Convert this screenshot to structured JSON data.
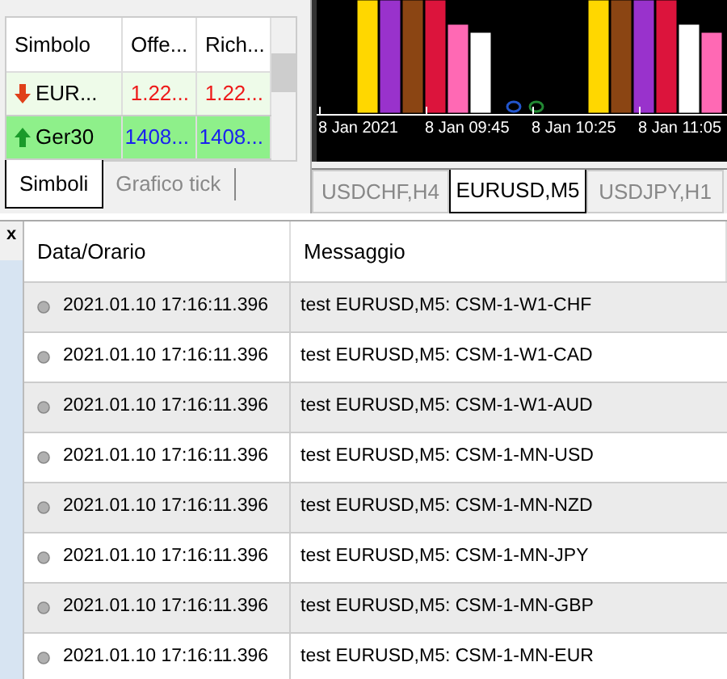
{
  "market_watch": {
    "columns": [
      "Simbolo",
      "Offe...",
      "Rich..."
    ],
    "rows": [
      {
        "symbol": "EUR...",
        "bid": "1.22...",
        "ask": "1.22...",
        "kind": "down"
      },
      {
        "symbol": "Ger30",
        "bid": "1408...",
        "ask": "1408...",
        "kind": "up"
      }
    ],
    "tabs": [
      {
        "label": "Simboli",
        "selected": true
      },
      {
        "label": "Grafico tick",
        "selected": false
      }
    ]
  },
  "chart": {
    "x_labels": [
      "8 Jan 2021",
      "8 Jan 09:45",
      "8 Jan 10:25",
      "8 Jan 11:05"
    ],
    "tabs": [
      {
        "label": "USDCHF,H4",
        "selected": false
      },
      {
        "label": "EURUSD,M5",
        "selected": true
      },
      {
        "label": "USDJPY,H1",
        "selected": false
      }
    ]
  },
  "journal": {
    "close": "x",
    "columns": [
      "Data/Orario",
      "Messaggio"
    ],
    "rows": [
      {
        "time": "2021.01.10 17:16:11.396",
        "message": "test EURUSD,M5: CSM-1-W1-CHF"
      },
      {
        "time": "2021.01.10 17:16:11.396",
        "message": "test EURUSD,M5: CSM-1-W1-CAD"
      },
      {
        "time": "2021.01.10 17:16:11.396",
        "message": "test EURUSD,M5: CSM-1-W1-AUD"
      },
      {
        "time": "2021.01.10 17:16:11.396",
        "message": "test EURUSD,M5: CSM-1-MN-USD"
      },
      {
        "time": "2021.01.10 17:16:11.396",
        "message": "test EURUSD,M5: CSM-1-MN-NZD"
      },
      {
        "time": "2021.01.10 17:16:11.396",
        "message": "test EURUSD,M5: CSM-1-MN-JPY"
      },
      {
        "time": "2021.01.10 17:16:11.396",
        "message": "test EURUSD,M5: CSM-1-MN-GBP"
      },
      {
        "time": "2021.01.10 17:16:11.396",
        "message": "test EURUSD,M5: CSM-1-MN-EUR"
      }
    ]
  }
}
